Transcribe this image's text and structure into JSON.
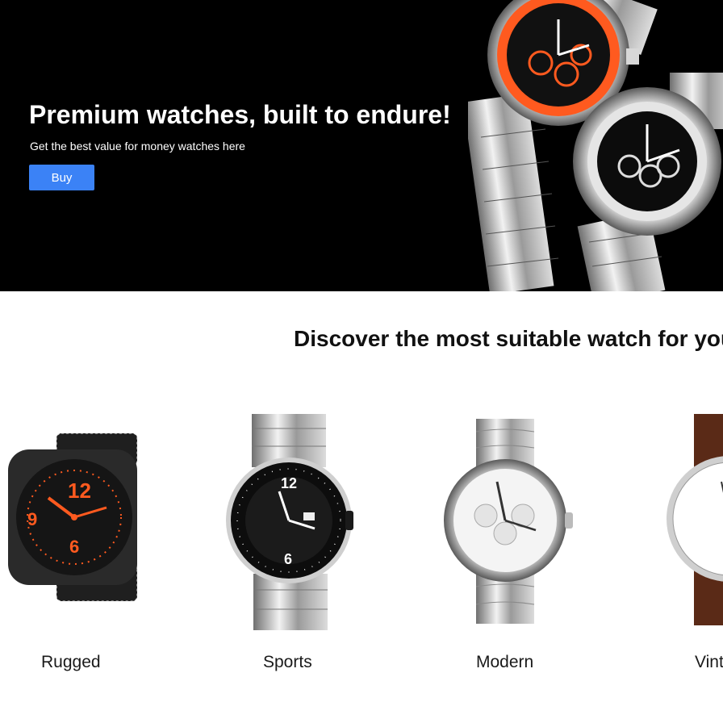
{
  "hero": {
    "title": "Premium watches, built to endure!",
    "subtitle": "Get the best value for money watches here",
    "buy_label": "Buy",
    "button_color": "#3b82f6",
    "accent_color": "#ff5a1f"
  },
  "discover": {
    "heading": "Discover the most suitable watch for you",
    "categories": [
      {
        "label": "Rugged",
        "icon": "rugged-watch-image"
      },
      {
        "label": "Sports",
        "icon": "sports-watch-image"
      },
      {
        "label": "Modern",
        "icon": "modern-watch-image"
      },
      {
        "label": "Vint",
        "icon": "vintage-watch-image"
      }
    ]
  }
}
